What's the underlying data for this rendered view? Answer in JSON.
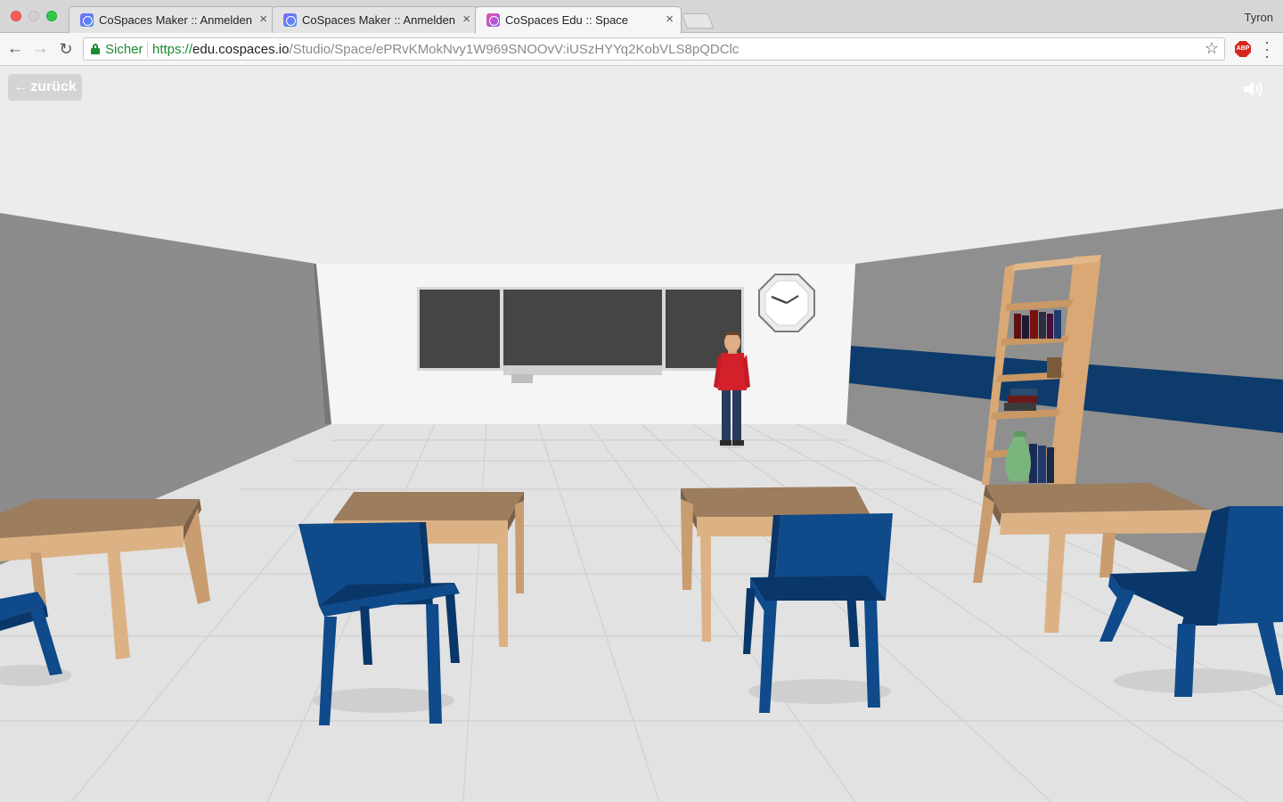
{
  "browser": {
    "tabs": [
      {
        "title": "CoSpaces Maker :: Anmelden",
        "close": "×",
        "active": false,
        "favicon": "cospaces-maker-favicon"
      },
      {
        "title": "CoSpaces Maker :: Anmelden",
        "close": "×",
        "active": false,
        "favicon": "cospaces-maker-favicon"
      },
      {
        "title": "CoSpaces Edu :: Space",
        "close": "×",
        "active": true,
        "favicon": "cospaces-edu-favicon"
      }
    ],
    "profile_name": "Tyron",
    "security_label": "Sicher",
    "url": {
      "scheme": "https://",
      "host": "edu.cospaces.io",
      "path": "/Studio/Space/ePRvKMokNvy1W969SNOOvV:iUSzHYYq2KobVLS8pQDClc"
    },
    "extension_badge": "ABP"
  },
  "viewer": {
    "back_label": "zurück",
    "sound_icon": "speaker-icon"
  },
  "scene_colors": {
    "ceiling": "#ececec",
    "left_wall": "#8c8c8c",
    "right_wall": "#8f8f8f",
    "back_wall": "#f5f5f5",
    "floor": "#e2e2e2",
    "wall_stripe": "#0d3b6b",
    "chalkboard": "#454545",
    "desk_top": "#9c7d5e",
    "desk_leg": "#dcb285",
    "chair": "#0f4a8a",
    "shelf": "#d9a874",
    "character_shirt": "#d3202a",
    "character_pants": "#2a3a5c"
  }
}
